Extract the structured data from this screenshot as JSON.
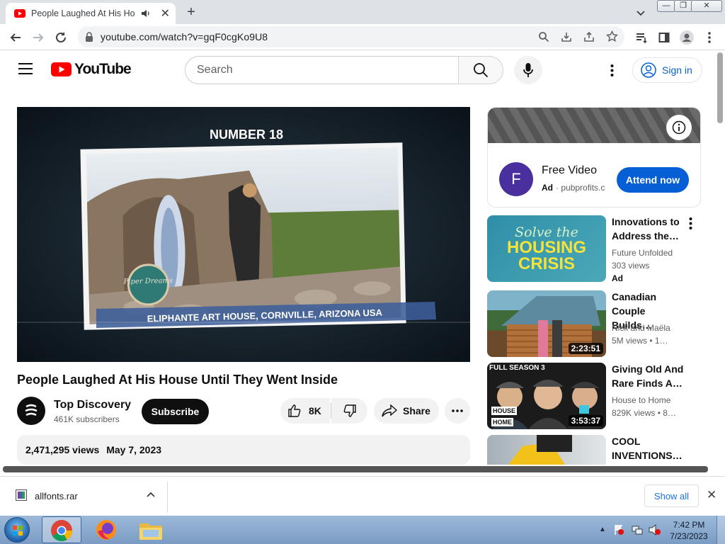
{
  "browser": {
    "tab_title": "People Laughed At His House",
    "new_tab": "+",
    "url": "youtube.com/watch?v=gqF0cgKo9U8"
  },
  "youtube": {
    "logo_text": "YouTube",
    "search_placeholder": "Search",
    "sign_in": "Sign in"
  },
  "video": {
    "overlay_number": "NUMBER 18",
    "overlay_caption": "ELIPHANTE ART HOUSE, CORNVILLE, ARIZONA USA",
    "sign_text": "Piper Dreams",
    "title": "People Laughed At His House Until They Went Inside",
    "channel": "Top Discovery",
    "subscribers": "461K subscribers",
    "subscribe": "Subscribe",
    "likes": "8K",
    "share": "Share",
    "views": "2,471,295 views",
    "date": "May 7, 2023"
  },
  "ad": {
    "avatar_letter": "F",
    "title": "Free Video",
    "badge": "Ad",
    "domain": "pubprofits.c",
    "cta": "Attend now"
  },
  "related": [
    {
      "title1": "Innovations to",
      "title2": "Address the…",
      "channel": "Future Unfolded",
      "meta": "303 views",
      "badge": "Ad",
      "thumb_line1": "Solve the",
      "thumb_line2": "HOUSING",
      "thumb_line3": "CRISIS"
    },
    {
      "title1": "Canadian",
      "title2": "Couple Builds…",
      "channel": "Nick and Maëla",
      "meta": "5M views  • 1…",
      "duration": "2:23:51"
    },
    {
      "title1": "Giving Old And",
      "title2": "Rare Finds A…",
      "channel": "House to Home",
      "meta": "829K views  • 8…",
      "duration": "3:53:37",
      "thumb_top": "FULL SEASON 3",
      "thumb_logo1": "HOUSE",
      "thumb_logo2": "HOME"
    },
    {
      "title1": "COOL",
      "title2": "INVENTIONS…"
    }
  ],
  "download": {
    "filename": "allfonts.rar",
    "show_all": "Show all"
  },
  "taskbar": {
    "time": "7:42 PM",
    "date": "7/23/2023"
  },
  "colors": {
    "yt_red": "#ff0000",
    "blue": "#065fd4",
    "attend_blue": "#065fd4"
  }
}
